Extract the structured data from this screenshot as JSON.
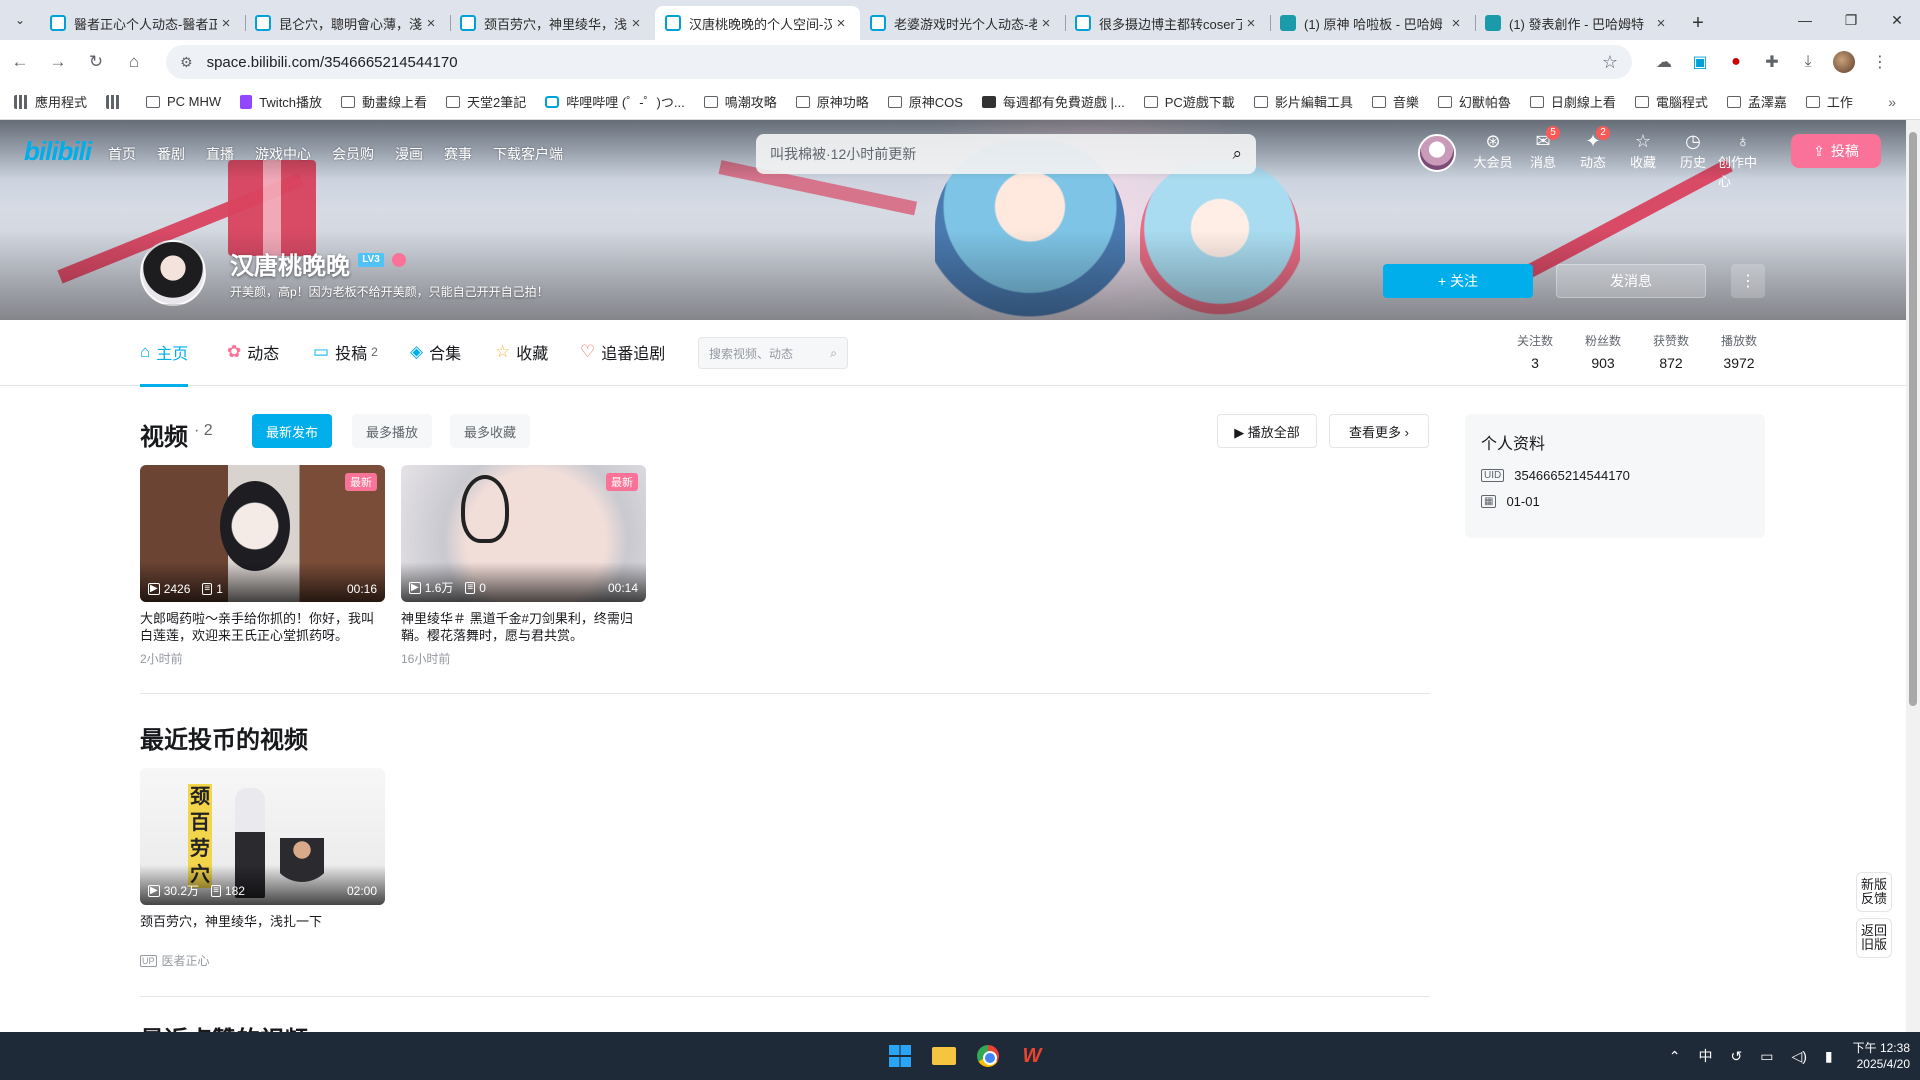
{
  "browser": {
    "tabs": [
      {
        "title": "醫者正心个人动态-醫者正",
        "icon": "bilibili-icon"
      },
      {
        "title": "昆仑穴，聰明會心薄，淺扎",
        "icon": "bilibili-icon"
      },
      {
        "title": "颈百劳穴，神里绫华，浅扎",
        "icon": "bilibili-icon"
      },
      {
        "title": "汉唐桃晚晚的个人空间-汉",
        "icon": "bilibili-icon",
        "active": true
      },
      {
        "title": "老婆游戏时光个人动态-老",
        "icon": "bilibili-icon"
      },
      {
        "title": "很多摄边博主都转coser了",
        "icon": "bilibili-icon"
      },
      {
        "title": "(1) 原神 哈啦板 - 巴哈姆",
        "icon": "bahamut-icon"
      },
      {
        "title": "(1) 發表創作 - 巴哈姆特",
        "icon": "bahamut-icon"
      }
    ],
    "url": "space.bilibili.com/3546665214544170",
    "bookmarks": [
      "應用程式",
      "PC MHW",
      "Twitch播放",
      "動畫線上看",
      "天堂2筆記",
      "哔哩哔哩 (゜-゜)つ...",
      "鳴潮攻略",
      "原神功略",
      "原神COS",
      "每週都有免費遊戲 |...",
      "PC遊戲下載",
      "影片編輯工具",
      "音樂",
      "幻獸帕魯",
      "日劇線上看",
      "電腦程式",
      "孟澤嘉",
      "工作"
    ]
  },
  "header": {
    "logo": "bilibili",
    "nav": [
      "首页",
      "番剧",
      "直播",
      "游戏中心",
      "会员购",
      "漫画",
      "赛事",
      "下载客户端"
    ],
    "search_placeholder": "叫我棉被·12小时前更新",
    "right_items": [
      {
        "label": "大会员",
        "icon": "vip-icon"
      },
      {
        "label": "消息",
        "icon": "message-icon",
        "badge": "5"
      },
      {
        "label": "动态",
        "icon": "dynamic-icon",
        "badge": "2"
      },
      {
        "label": "收藏",
        "icon": "star-icon"
      },
      {
        "label": "历史",
        "icon": "history-icon"
      },
      {
        "label": "创作中心",
        "icon": "creator-icon"
      }
    ],
    "upload_label": "投稿"
  },
  "profile": {
    "name": "汉唐桃晚晚",
    "level": "LV3",
    "sign": "开美颜，高p！因为老板不给开美颜，只能自己开开自己拍！",
    "follow_label": "+ 关注",
    "message_label": "发消息",
    "more_label": "⋮"
  },
  "subnav": {
    "tabs": [
      {
        "label": "主页",
        "icon": "home-icon",
        "active": true
      },
      {
        "label": "动态",
        "icon": "dynamic-icon"
      },
      {
        "label": "投稿",
        "icon": "upload-icon",
        "count": "2"
      },
      {
        "label": "合集",
        "icon": "collection-icon"
      },
      {
        "label": "收藏",
        "icon": "star-icon"
      },
      {
        "label": "追番追剧",
        "icon": "heart-icon"
      }
    ],
    "search_placeholder": "搜索视频、动态",
    "stats": [
      {
        "label": "关注数",
        "value": "3"
      },
      {
        "label": "粉丝数",
        "value": "903"
      },
      {
        "label": "获赞数",
        "value": "872"
      },
      {
        "label": "播放数",
        "value": "3972"
      }
    ]
  },
  "videos_section": {
    "title": "视频",
    "count": "· 2",
    "sort": [
      "最新发布",
      "最多播放",
      "最多收藏"
    ],
    "play_all": "▶ 播放全部",
    "see_more": "查看更多 ›",
    "items": [
      {
        "tag": "最新",
        "views": "2426",
        "comments": "1",
        "duration": "00:16",
        "title": "大郎喝药啦～亲手给你抓的！你好，我叫白莲莲，欢迎来王氏正心堂抓药呀。",
        "time": "2小时前"
      },
      {
        "tag": "最新",
        "views": "1.6万",
        "comments": "0",
        "duration": "00:14",
        "title": "神里绫华＃ 黑道千金#刀剑果利，终需归鞘。樱花落舞时，愿与君共赏。",
        "time": "16小时前"
      }
    ]
  },
  "coin_section": {
    "title": "最近投币的视频",
    "items": [
      {
        "thumb_text": "颈百劳穴",
        "views": "30.2万",
        "comments": "182",
        "duration": "02:00",
        "title": "颈百劳穴，神里绫华，浅扎一下",
        "author": "医者正心"
      }
    ]
  },
  "like_section": {
    "title": "最近点赞的视频"
  },
  "side": {
    "title": "个人资料",
    "uid": "3546665214544170",
    "birthday": "01-01"
  },
  "float": {
    "feedback": "新版反馈",
    "back": "返回旧版"
  },
  "taskbar": {
    "ime": "中",
    "time": "下午 12:38",
    "date": "2025/4/20"
  }
}
